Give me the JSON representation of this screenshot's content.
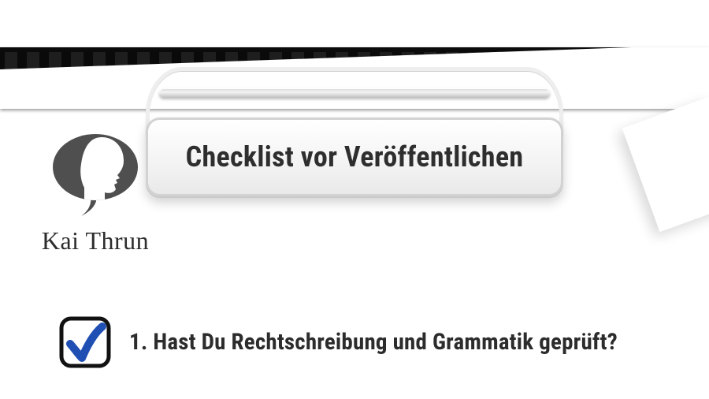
{
  "header": {
    "title": "Checklist vor Veröffentlichen"
  },
  "brand": {
    "name": "Kai Thrun"
  },
  "checklist": {
    "items": [
      {
        "checked": true,
        "label": "1. Hast Du Rechtschreibung und Grammatik geprüft?"
      }
    ]
  },
  "colors": {
    "checkboxStroke": "#111111",
    "tick": "#1f4fb3",
    "logoFill": "#4f4f4f"
  }
}
